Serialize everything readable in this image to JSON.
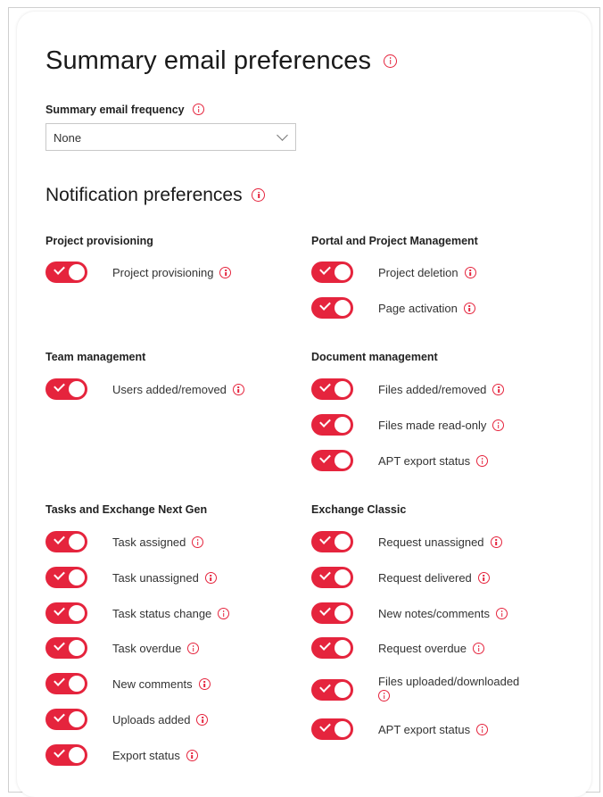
{
  "page": {
    "title": "Summary email preferences",
    "frequency_label": "Summary email frequency",
    "frequency_value": "None",
    "notification_title": "Notification preferences"
  },
  "colors": {
    "accent": "#e5243d",
    "border": "#c8c8c8"
  },
  "icons": {
    "info": "info-icon",
    "dropdown": "chevron-down-icon",
    "toggle_check": "check-icon"
  },
  "groups": {
    "project_provisioning": {
      "title": "Project provisioning",
      "items": [
        {
          "label": "Project provisioning",
          "on": true
        }
      ]
    },
    "portal_project_management": {
      "title": "Portal and Project Management",
      "items": [
        {
          "label": "Project deletion",
          "on": true
        },
        {
          "label": "Page activation",
          "on": true
        }
      ]
    },
    "team_management": {
      "title": "Team management",
      "items": [
        {
          "label": "Users added/removed",
          "on": true
        }
      ]
    },
    "document_management": {
      "title": "Document management",
      "items": [
        {
          "label": "Files added/removed",
          "on": true
        },
        {
          "label": "Files made read-only",
          "on": true
        },
        {
          "label": "APT export status",
          "on": true
        }
      ]
    },
    "tasks_exchange_next_gen": {
      "title": "Tasks and Exchange Next Gen",
      "items": [
        {
          "label": "Task assigned",
          "on": true
        },
        {
          "label": "Task unassigned",
          "on": true
        },
        {
          "label": "Task status change",
          "on": true
        },
        {
          "label": "Task overdue",
          "on": true
        },
        {
          "label": "New comments",
          "on": true
        },
        {
          "label": "Uploads added",
          "on": true
        },
        {
          "label": "Export status",
          "on": true
        }
      ]
    },
    "exchange_classic": {
      "title": "Exchange Classic",
      "items": [
        {
          "label": "Request unassigned",
          "on": true
        },
        {
          "label": "Request delivered",
          "on": true
        },
        {
          "label": "New notes/comments",
          "on": true
        },
        {
          "label": "Request overdue",
          "on": true
        },
        {
          "label": "Files uploaded/downloaded",
          "on": true
        },
        {
          "label": "APT export status",
          "on": true
        }
      ]
    }
  }
}
